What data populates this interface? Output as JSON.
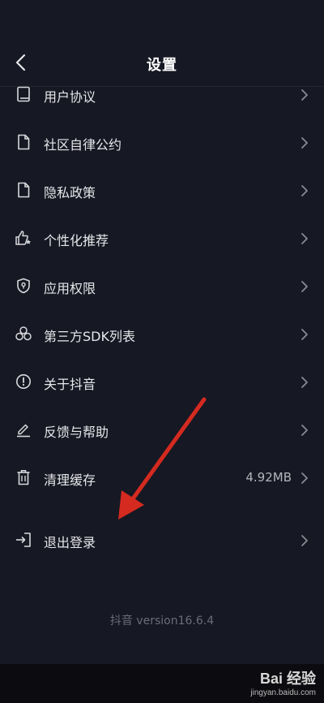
{
  "header": {
    "title": "设置"
  },
  "menu": [
    {
      "label": "用户协议",
      "icon": "book-icon"
    },
    {
      "label": "社区自律公约",
      "icon": "document-icon"
    },
    {
      "label": "隐私政策",
      "icon": "document-icon"
    },
    {
      "label": "个性化推荐",
      "icon": "thumbs-up-icon"
    },
    {
      "label": "应用权限",
      "icon": "shield-icon"
    },
    {
      "label": "第三方SDK列表",
      "icon": "cluster-icon"
    },
    {
      "label": "关于抖音",
      "icon": "info-icon"
    },
    {
      "label": "反馈与帮助",
      "icon": "pencil-icon"
    },
    {
      "label": "清理缓存",
      "icon": "trash-icon",
      "value": "4.92MB"
    }
  ],
  "logout": {
    "label": "退出登录",
    "icon": "logout-icon"
  },
  "footer": {
    "version": "抖音 version16.6.4"
  },
  "watermark": {
    "brand": "Bai 经验",
    "url": "jingyan.baidu.com"
  },
  "colors": {
    "background": "#161823",
    "text": "#e6e6ea",
    "arrow": "#d42a20"
  }
}
